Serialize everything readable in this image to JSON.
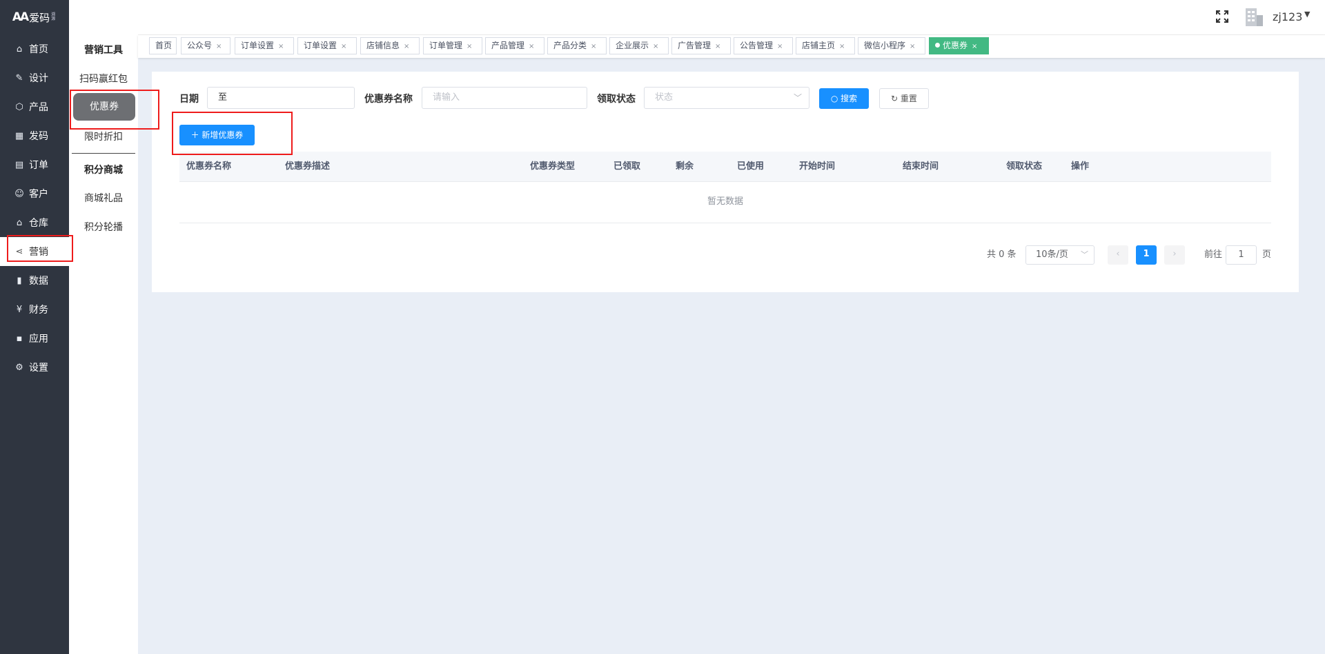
{
  "brand": {
    "mark": "AA",
    "name": "爱码",
    "sub": "溯源"
  },
  "nav": [
    {
      "label": "首页",
      "icon": "home-icon",
      "glyph": "⌂"
    },
    {
      "label": "设计",
      "icon": "design-tools-icon",
      "glyph": "✎"
    },
    {
      "label": "产品",
      "icon": "cube-icon",
      "glyph": "⬡"
    },
    {
      "label": "发码",
      "icon": "qrcode-icon",
      "glyph": "▦"
    },
    {
      "label": "订单",
      "icon": "clipboard-icon",
      "glyph": "▤"
    },
    {
      "label": "客户",
      "icon": "users-icon",
      "glyph": "☺"
    },
    {
      "label": "仓库",
      "icon": "warehouse-icon",
      "glyph": "⌂"
    },
    {
      "label": "营销",
      "icon": "share-icon",
      "glyph": "⋖"
    },
    {
      "label": "数据",
      "icon": "bar-chart-icon",
      "glyph": "▮"
    },
    {
      "label": "财务",
      "icon": "yen-icon",
      "glyph": "¥"
    },
    {
      "label": "应用",
      "icon": "grid-apps-icon",
      "glyph": "▪"
    },
    {
      "label": "设置",
      "icon": "gear-icon",
      "glyph": "⚙"
    }
  ],
  "submenu": {
    "group1_title": "营销工具",
    "group1_items": [
      "扫码赢红包",
      "优惠券",
      "限时折扣"
    ],
    "group2_title": "积分商城",
    "group2_items": [
      "商城礼品",
      "积分轮播"
    ]
  },
  "header": {
    "username": "zj123",
    "fullscreen_icon": "fullscreen-icon",
    "avatar_icon": "building-avatar-icon"
  },
  "tabs": [
    "首页",
    "公众号",
    "订单设置",
    "订单设置",
    "店铺信息",
    "订单管理",
    "产品管理",
    "产品分类",
    "企业展示",
    "广告管理",
    "公告管理",
    "店铺主页",
    "微信小程序",
    "优惠券"
  ],
  "tab_close": "×",
  "filters": {
    "date_label": "日期",
    "date_separator": "至",
    "name_label": "优惠券名称",
    "name_placeholder": "请输入",
    "status_label": "领取状态",
    "status_placeholder": "状态",
    "search_button": "搜索",
    "reset_button": "重置"
  },
  "add_button": "新增优惠券",
  "table": {
    "columns": [
      "优惠券名称",
      "优惠券描述",
      "优惠券类型",
      "已领取",
      "剩余",
      "已使用",
      "开始时间",
      "结束时间",
      "领取状态",
      "操作"
    ],
    "empty_text": "暂无数据"
  },
  "pagination": {
    "total_text": "共 0 条",
    "page_size": "10条/页",
    "current_page": "1",
    "goto_label": "前往",
    "goto_value": "1",
    "goto_suffix": "页"
  },
  "colors": {
    "primary": "#1890ff",
    "tab_active": "#42b983",
    "sidebar": "#2f3540",
    "highlight_box": "#ee1b1b"
  }
}
